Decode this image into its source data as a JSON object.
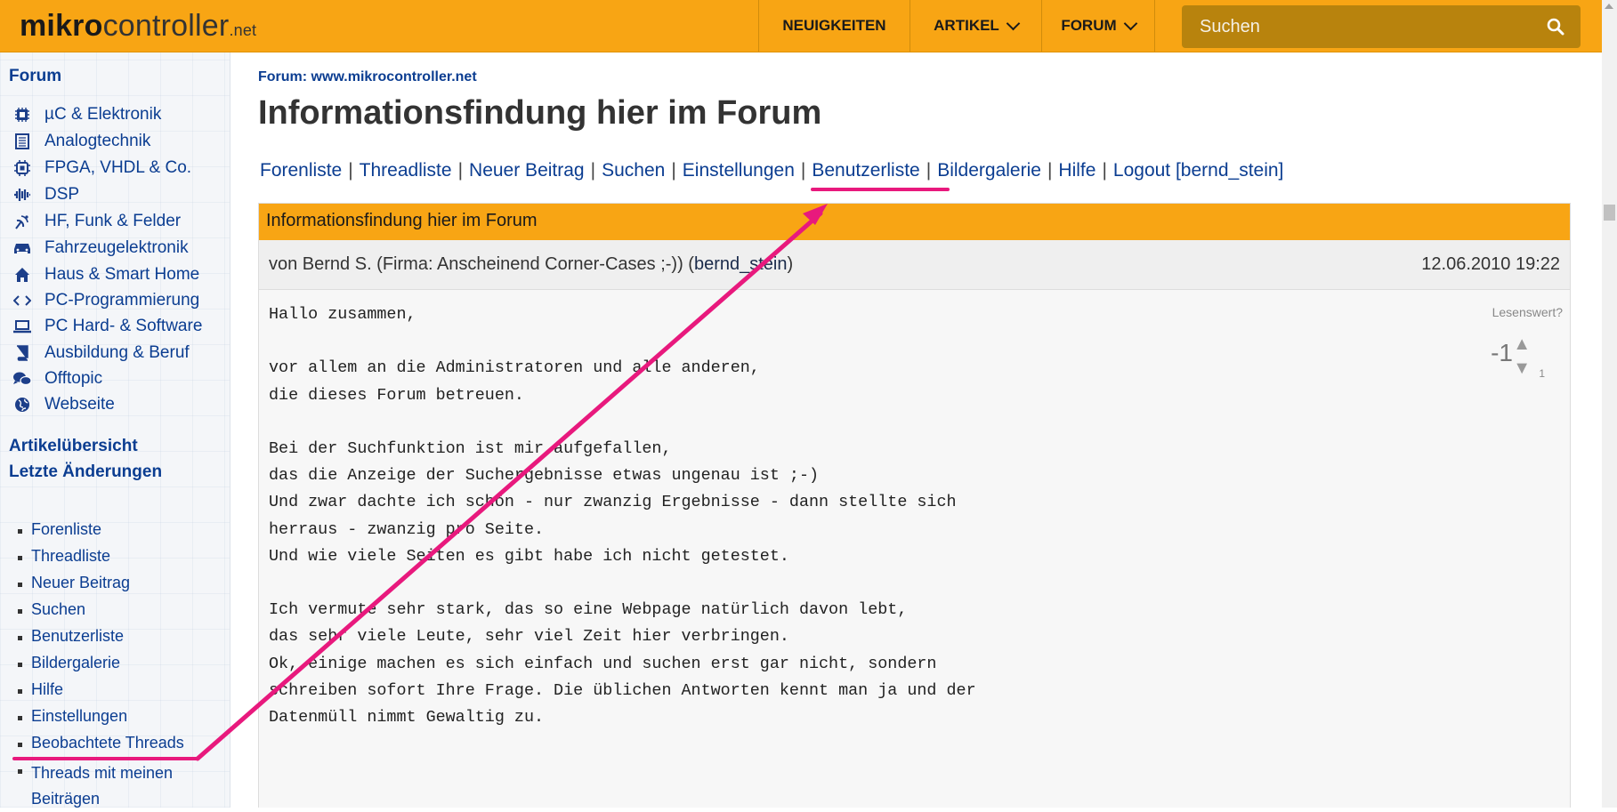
{
  "header": {
    "logo_bold": "mikro",
    "logo_rest": "controller",
    "logo_suffix": ".net",
    "nav": [
      "NEUIGKEITEN",
      "ARTIKEL",
      "FORUM"
    ],
    "search_placeholder": "Suchen"
  },
  "sidebar": {
    "title": "Forum",
    "categories": [
      {
        "label": "µC & Elektronik",
        "icon": "chip-icon"
      },
      {
        "label": "Analogtechnik",
        "icon": "analog-icon"
      },
      {
        "label": "FPGA, VHDL & Co.",
        "icon": "processor-icon"
      },
      {
        "label": "DSP",
        "icon": "waveform-icon"
      },
      {
        "label": "HF, Funk & Felder",
        "icon": "antenna-icon"
      },
      {
        "label": "Fahrzeugelektronik",
        "icon": "car-icon"
      },
      {
        "label": "Haus & Smart Home",
        "icon": "house-icon"
      },
      {
        "label": "PC-Programmierung",
        "icon": "code-icon"
      },
      {
        "label": "PC Hard- & Software",
        "icon": "laptop-icon"
      },
      {
        "label": "Ausbildung & Beruf",
        "icon": "book-icon"
      },
      {
        "label": "Offtopic",
        "icon": "chat-icon"
      },
      {
        "label": "Webseite",
        "icon": "globe-icon"
      }
    ],
    "articles_overview": "Artikelübersicht",
    "latest_changes": "Letzte Änderungen",
    "links": [
      "Forenliste",
      "Threadliste",
      "Neuer Beitrag",
      "Suchen",
      "Benutzerliste",
      "Bildergalerie",
      "Hilfe",
      "Einstellungen",
      "Beobachtete Threads",
      "Threads mit meinen Beiträgen"
    ]
  },
  "main": {
    "breadcrumb": "Forum: www.mikrocontroller.net",
    "title": "Informationsfindung hier im Forum",
    "actions": [
      "Forenliste",
      "Threadliste",
      "Neuer Beitrag",
      "Suchen",
      "Einstellungen",
      "Benutzerliste",
      "Bildergalerie",
      "Hilfe",
      "Logout [bernd_stein]"
    ],
    "post": {
      "subject": "Informationsfindung hier im Forum",
      "author_prefix": "von Bernd S. (Firma: Anscheinend Corner-Cases ;-)) (",
      "author_user": "bernd_stein",
      "author_suffix": ")",
      "date": "12.06.2010 19:22",
      "body": "Hallo zusammen,\n\nvor allem an die Administratoren und alle anderen,\ndie dieses Forum betreuen.\n\nBei der Suchfunktion ist mir aufgefallen,\ndas die Anzeige der Suchergebnisse etwas ungenau ist ;-)\nUnd zwar dachte ich schön - nur zwanzig Ergebnisse - dann stellte sich\nherraus - zwanzig pro Seite.\nUnd wie viele Seiten es gibt habe ich nicht getestet.\n\nIch vermute sehr stark, das so eine Webpage natürlich davon lebt,\ndas sehr viele Leute, sehr viel Zeit hier verbringen.\nOk, einige machen es sich einfach und suchen erst gar nicht, sondern\nschreiben sofort Ihre Frage. Die üblichen Antworten kennt man ja und der\nDatenmüll nimmt Gewaltig zu.",
      "rating_label": "Lesenswert?",
      "rating_score": "-1",
      "rating_count": "1"
    }
  },
  "colors": {
    "brand": "#f8a514",
    "link": "#0b3d91",
    "annotation": "#e8197d"
  }
}
